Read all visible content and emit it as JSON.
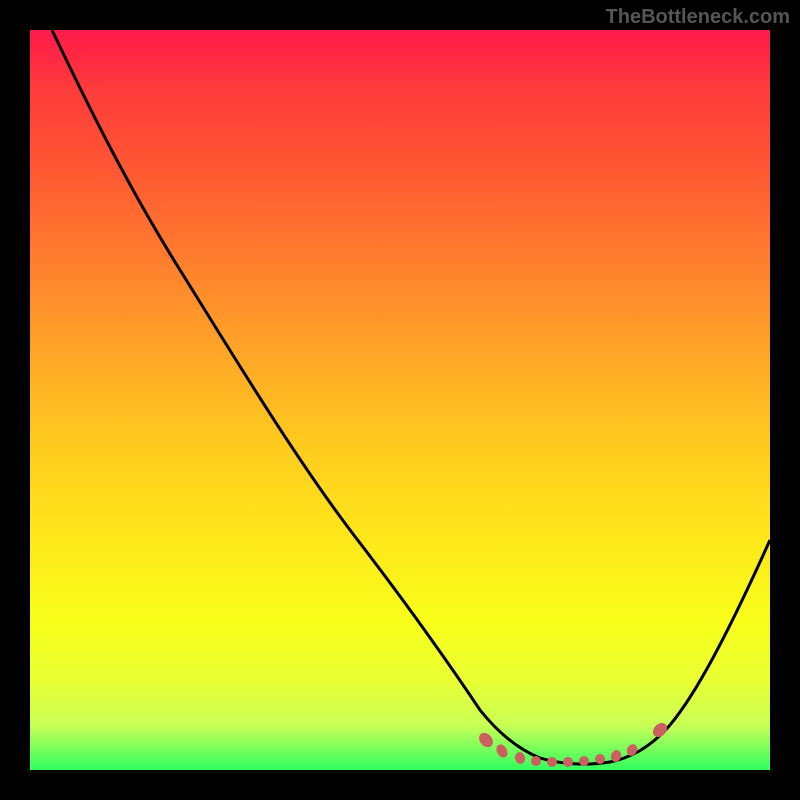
{
  "watermark": "TheBottleneck.com",
  "chart_data": {
    "type": "line",
    "title": "",
    "xlabel": "",
    "ylabel": "",
    "xlim": [
      0,
      100
    ],
    "ylim": [
      0,
      100
    ],
    "grid": false,
    "series": [
      {
        "name": "bottleneck-curve",
        "color": "#000000",
        "x": [
          3,
          10,
          20,
          30,
          40,
          50,
          56,
          60,
          64,
          68,
          72,
          76,
          80,
          84,
          88,
          92,
          96,
          100
        ],
        "y": [
          100,
          88,
          72,
          56,
          40,
          24,
          14,
          8,
          4,
          2,
          1,
          1,
          2,
          4,
          10,
          18,
          28,
          40
        ]
      },
      {
        "name": "optimal-zone-markers",
        "color": "#dd6666",
        "type": "scatter",
        "x": [
          62,
          65,
          68,
          70,
          72,
          74,
          76,
          78,
          80,
          82,
          86
        ],
        "y": [
          3.5,
          2.8,
          2.2,
          2.0,
          1.8,
          1.8,
          1.8,
          2.0,
          2.4,
          3.0,
          5.0
        ]
      }
    ],
    "background_gradient": {
      "top": "#ff1a4a",
      "mid": "#ffe61a",
      "bottom": "#30ff60",
      "meaning": "red=high bottleneck, green=low bottleneck"
    }
  }
}
